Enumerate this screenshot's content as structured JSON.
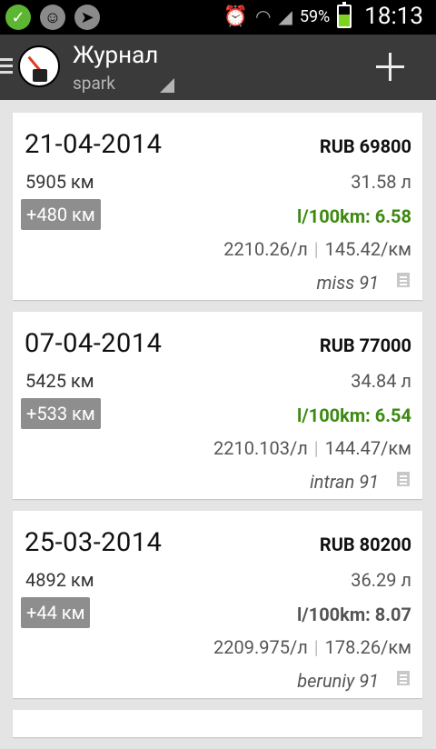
{
  "statusbar": {
    "battery_pct": "59%",
    "time": "18:13",
    "icons": [
      "check-icon",
      "sticker-icon",
      "navigation-icon",
      "alarm-icon",
      "wifi-icon",
      "signal-icon",
      "battery-icon"
    ]
  },
  "header": {
    "title": "Журнал",
    "subtitle": "spark"
  },
  "colors": {
    "consumption_good": "#3d8a12",
    "consumption_bad": "#555555",
    "actionbar": "#3a3a3a",
    "distance_badge": "#8e8e8e"
  },
  "entries": [
    {
      "date": "21-04-2014",
      "cost": "RUB 69800",
      "odometer": "5905 км",
      "volume": "31.58 л",
      "distance": "+480 км",
      "consumption": "l/100km: 6.58",
      "consumption_color": "#3d8a12",
      "price_per_liter": "2210.26/л",
      "price_per_km": "145.42/км",
      "station": "miss 91"
    },
    {
      "date": "07-04-2014",
      "cost": "RUB 77000",
      "odometer": "5425 км",
      "volume": "34.84 л",
      "distance": "+533 км",
      "consumption": "l/100km: 6.54",
      "consumption_color": "#3d8a12",
      "price_per_liter": "2210.103/л",
      "price_per_km": "144.47/км",
      "station": "intran 91"
    },
    {
      "date": "25-03-2014",
      "cost": "RUB 80200",
      "odometer": "4892 км",
      "volume": "36.29 л",
      "distance": "+44 км",
      "consumption": "l/100km: 8.07",
      "consumption_color": "#555555",
      "price_per_liter": "2209.975/л",
      "price_per_km": "178.26/км",
      "station": "beruniy 91"
    }
  ]
}
